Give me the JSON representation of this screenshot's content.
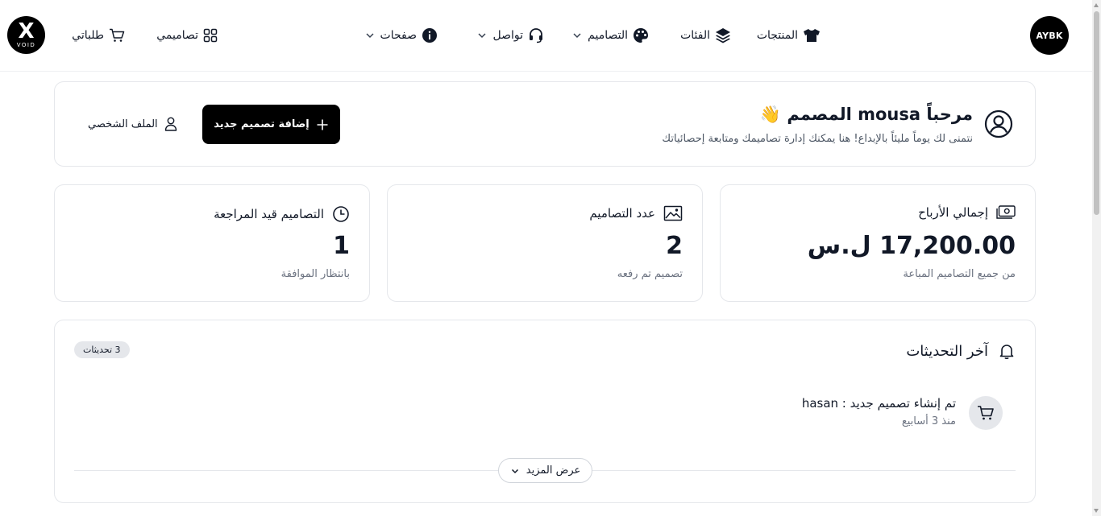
{
  "nav": {
    "brand_right": "AYBK",
    "brand_left_mark": "X",
    "brand_left_word": "VOID",
    "products": "المنتجات",
    "categories": "الفئات",
    "designs": "التصاميم",
    "contact": "تواصل",
    "pages": "صفحات",
    "my_designs": "تصاميمي",
    "my_orders": "طلباتي"
  },
  "welcome": {
    "title": "مرحباً mousa المصمم 👋",
    "subtitle": "نتمنى لك يوماً مليئاً بالإبداع! هنا يمكنك إدارة تصاميمك ومتابعة إحصائياتك",
    "add_button": "إضافة تصميم جديد",
    "profile_link": "الملف الشخصي"
  },
  "stats": [
    {
      "label": "إجمالي الأرباح",
      "value": "17,200.00 ل.س",
      "note": "من جميع التصاميم المباعة",
      "icon": "money-icon"
    },
    {
      "label": "عدد التصاميم",
      "value": "2",
      "note": "تصميم تم رفعه",
      "icon": "image-icon"
    },
    {
      "label": "التصاميم قيد المراجعة",
      "value": "1",
      "note": "بانتظار الموافقة",
      "icon": "clock-icon"
    }
  ],
  "updates": {
    "title": "آخر التحديثات",
    "badge": "3 تحديثات",
    "items": [
      {
        "text": "تم إنشاء تصميم جديد : hasan",
        "time": "منذ 3 أسابيع",
        "icon": "cart-icon"
      }
    ],
    "more_button": "عرض المزيد"
  }
}
